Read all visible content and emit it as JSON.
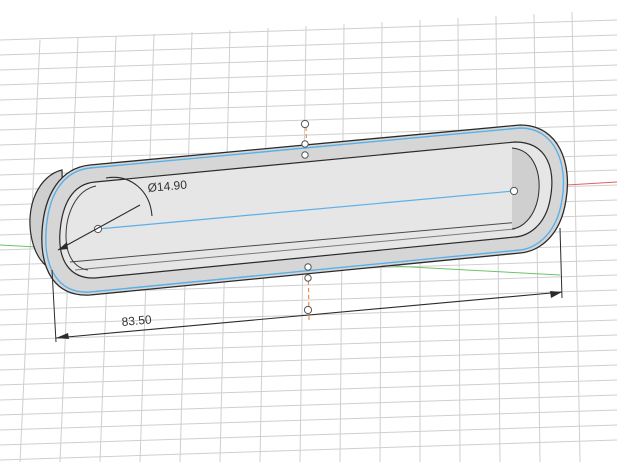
{
  "viewport": {
    "background": "#ffffff",
    "grid_color": "#c8c8c8",
    "axis_x_color": "#e06060",
    "axis_y_color": "#6ac46a",
    "axis_z_color": "#f08a4b",
    "sketch_line_color": "#5ab0e8",
    "body_color": "#d9d9d9",
    "body_edge_color": "#2b2b2b"
  },
  "dimensions": {
    "diameter_label": "Ø14.90",
    "length_label": "83.50"
  }
}
